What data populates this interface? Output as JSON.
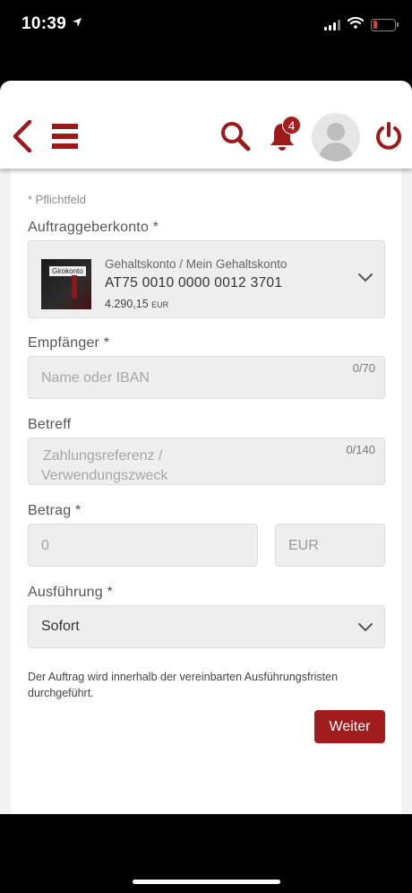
{
  "status_bar": {
    "time": "10:39"
  },
  "header": {
    "notification_count": "4"
  },
  "form": {
    "required_note": "* Pflichtfeld",
    "account": {
      "label": "Auftraggeberkonto *",
      "thumb_label": "Girokonto",
      "name": "Gehaltskonto / Mein Gehaltskonto",
      "iban": "AT75 0010 0000 0012 3701",
      "balance": "4.290,15",
      "balance_currency": "EUR"
    },
    "recipient": {
      "label": "Empfänger *",
      "placeholder": "Name oder IBAN",
      "counter": "0/70"
    },
    "reference": {
      "label": "Betreff",
      "placeholder_line1": "Zahlungsreferenz /",
      "placeholder_line2": "Verwendungszweck",
      "counter": "0/140"
    },
    "amount": {
      "label": "Betrag *",
      "placeholder": "0",
      "currency": "EUR"
    },
    "execution": {
      "label": "Ausführung *",
      "value": "Sofort"
    },
    "info_text": "Der Auftrag wird innerhalb der vereinbarten Ausführungsfristen durchgeführt.",
    "submit_label": "Weiter"
  },
  "colors": {
    "brand": "#9b1b1b",
    "button": "#a11c1c",
    "battery": "#e53935"
  },
  "icons": [
    "location-arrow-icon",
    "signal-icon",
    "wifi-icon",
    "battery-icon",
    "back-icon",
    "menu-icon",
    "search-icon",
    "bell-icon",
    "avatar-icon",
    "power-icon",
    "chevron-down-icon"
  ]
}
